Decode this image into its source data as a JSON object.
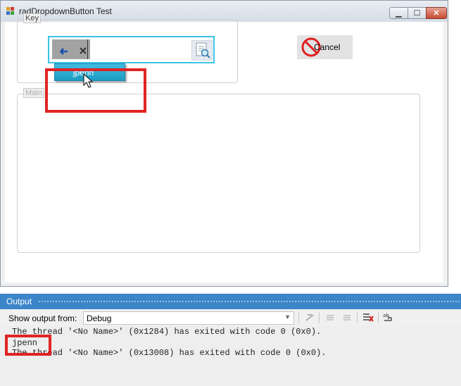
{
  "window": {
    "title": "radDropdownButton Test",
    "minimize_glyph": "▁",
    "maximize_glyph": "☐",
    "close_glyph": "✕"
  },
  "key_group": {
    "legend": "Key",
    "dropdown_selected": "jpenn",
    "search_icon": "search-document-icon"
  },
  "main_group": {
    "legend": "Main"
  },
  "cancel_button": {
    "label": "Cancel",
    "icon": "prohibited-icon"
  },
  "output_pane": {
    "title": "Output",
    "show_output_label": "Show output from:",
    "source_value": "Debug",
    "lines": [
      "The thread '<No Name>' (0x1284) has exited with code 0 (0x0).",
      "jpenn",
      "The thread '<No Name>' (0x13008) has exited with code 0 (0x0)."
    ]
  },
  "colors": {
    "dropdown_border": "#3cc3e8",
    "popup_fill": "#1c9cc4",
    "highlight": "#e02424",
    "output_titlebar": "#3b85c8"
  }
}
